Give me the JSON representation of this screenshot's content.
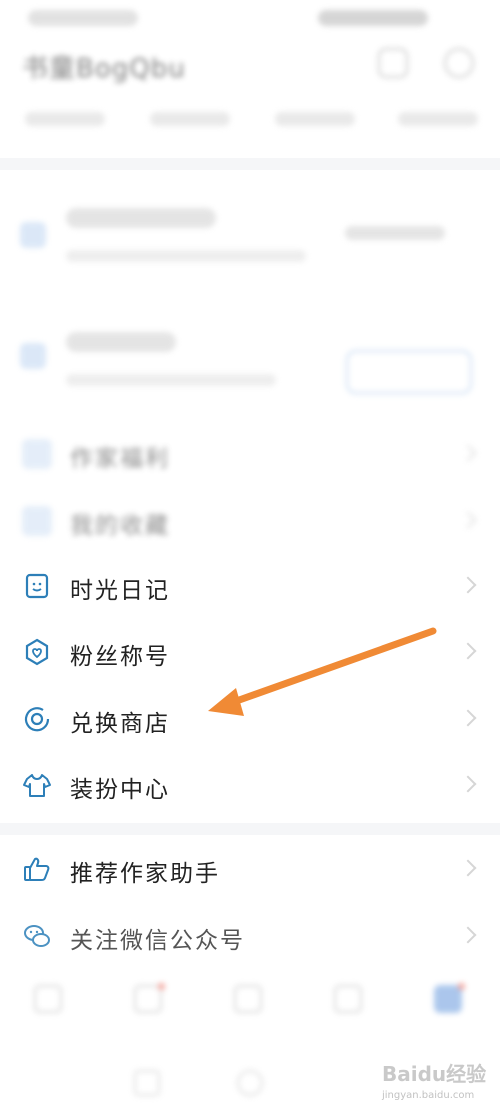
{
  "header": {
    "title": "书童BogQbu"
  },
  "menu": [
    {
      "label": "时光日记",
      "icon": "diary-icon"
    },
    {
      "label": "粉丝称号",
      "icon": "fan-badge-icon"
    },
    {
      "label": "兑换商店",
      "icon": "exchange-store-icon"
    },
    {
      "label": "装扮中心",
      "icon": "outfit-icon"
    },
    {
      "label": "推荐作家助手",
      "icon": "thumbs-up-icon"
    },
    {
      "label": "关注微信公众号",
      "icon": "wechat-icon"
    }
  ],
  "blurred": {
    "favorites": "我的收藏",
    "vip": "作家福利"
  },
  "watermark": {
    "brand": "Baidu经验",
    "site": "jingyan.baidu.com"
  },
  "colors": {
    "accent": "#2d7fb8",
    "arrow": "#f08a35"
  }
}
